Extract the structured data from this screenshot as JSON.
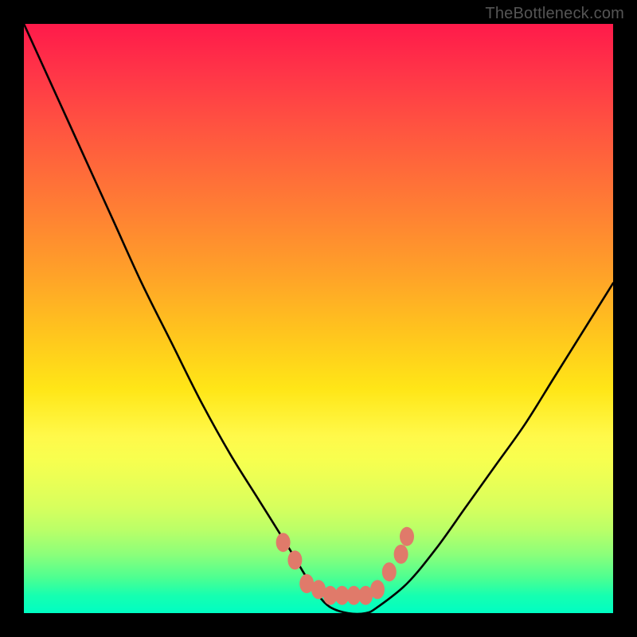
{
  "watermark": "TheBottleneck.com",
  "chart_data": {
    "type": "line",
    "title": "",
    "xlabel": "",
    "ylabel": "",
    "ylim": [
      0,
      100
    ],
    "xlim": [
      0,
      100
    ],
    "series": [
      {
        "name": "bottleneck-curve",
        "x": [
          0,
          5,
          10,
          15,
          20,
          25,
          30,
          35,
          40,
          45,
          48,
          50,
          52,
          55,
          58,
          60,
          65,
          70,
          75,
          80,
          85,
          90,
          95,
          100
        ],
        "values": [
          100,
          89,
          78,
          67,
          56,
          46,
          36,
          27,
          19,
          11,
          6,
          3,
          1,
          0,
          0,
          1,
          5,
          11,
          18,
          25,
          32,
          40,
          48,
          56
        ]
      }
    ],
    "markers": {
      "name": "highlight-dots",
      "color": "#e07a6a",
      "points": [
        {
          "x": 44,
          "y": 12
        },
        {
          "x": 46,
          "y": 9
        },
        {
          "x": 48,
          "y": 5
        },
        {
          "x": 50,
          "y": 4
        },
        {
          "x": 52,
          "y": 3
        },
        {
          "x": 54,
          "y": 3
        },
        {
          "x": 56,
          "y": 3
        },
        {
          "x": 58,
          "y": 3
        },
        {
          "x": 60,
          "y": 4
        },
        {
          "x": 62,
          "y": 7
        },
        {
          "x": 64,
          "y": 10
        },
        {
          "x": 65,
          "y": 13
        }
      ]
    }
  }
}
